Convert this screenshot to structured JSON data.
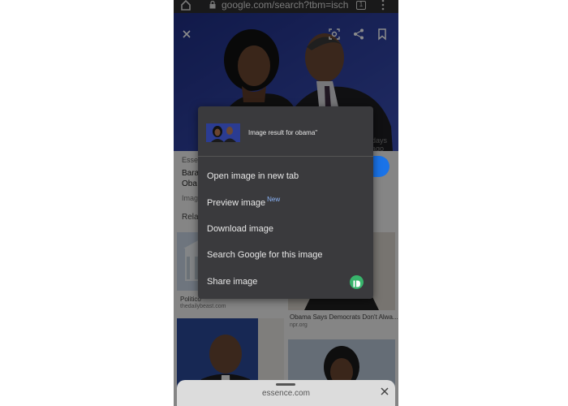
{
  "browser": {
    "url": "google.com/search?tbm=isch",
    "tab_count": "1"
  },
  "viewer": {
    "caption_right": "days ago"
  },
  "page": {
    "source_1": "Esse",
    "title_1a": "Bara",
    "title_1b": "Oba",
    "image_label": "Imag",
    "related": "Rela",
    "result_1_title": "Politico",
    "result_1_source": "thedailybeast.com",
    "result_2_title": "Obama Says Democrats Don't Alwa...",
    "result_2_source": "npr.org"
  },
  "menu": {
    "header_title": "Image result for obama\"",
    "items": [
      {
        "label": "Open image in new tab"
      },
      {
        "label": "Preview image",
        "badge": "New"
      },
      {
        "label": "Download image"
      },
      {
        "label": "Search Google for this image"
      },
      {
        "label": "Share image"
      }
    ]
  },
  "sheet": {
    "domain": "essence.com"
  },
  "colors": {
    "menu_bg": "#3a3a3d",
    "accent_blue": "#1a73e8",
    "new_badge": "#8ab4f8",
    "share_app": "#38b36b"
  }
}
